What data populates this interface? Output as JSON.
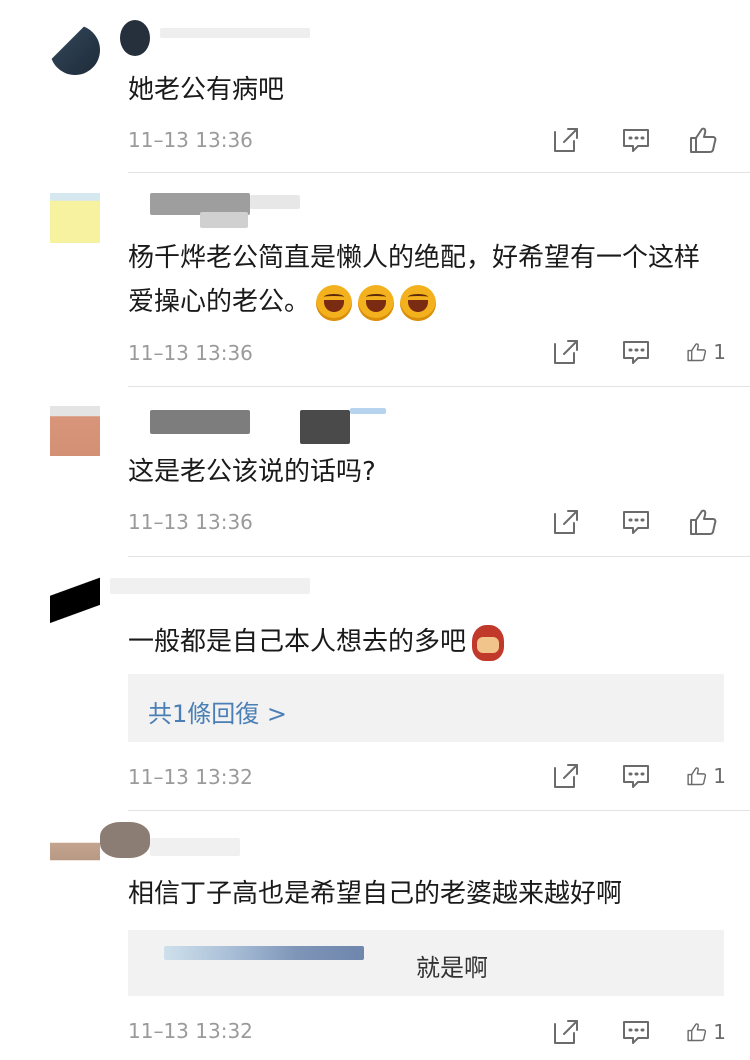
{
  "comments": [
    {
      "text": "她老公有病吧",
      "time": "11–13 13:36",
      "like_count": ""
    },
    {
      "text": "杨千烨老公简直是懒人的绝配，好希望有一个这样爱操心的老公。",
      "emoji": [
        "grin-emoji",
        "grin-emoji",
        "grin-emoji"
      ],
      "time": "11–13 13:36",
      "like_count": "1"
    },
    {
      "text": "这是老公该说的话吗?",
      "time": "11–13 13:36",
      "like_count": ""
    },
    {
      "text": "一般都是自己本人想去的多吧",
      "emoji": [
        "mask-emoji"
      ],
      "reply_link": "共1條回復 >",
      "time": "11–13 13:32",
      "like_count": "1"
    },
    {
      "text": "相信丁子高也是希望自己的老婆越来越好啊",
      "reply_text": "就是啊",
      "time": "11–13 13:32",
      "like_count": "1"
    }
  ],
  "icons": {
    "share": "share-icon",
    "comment": "comment-icon",
    "like": "thumbs-up-icon"
  },
  "colors": {
    "link": "#4a7fb5",
    "meta": "#9a9a9a",
    "reply_bg": "#f2f2f2"
  }
}
